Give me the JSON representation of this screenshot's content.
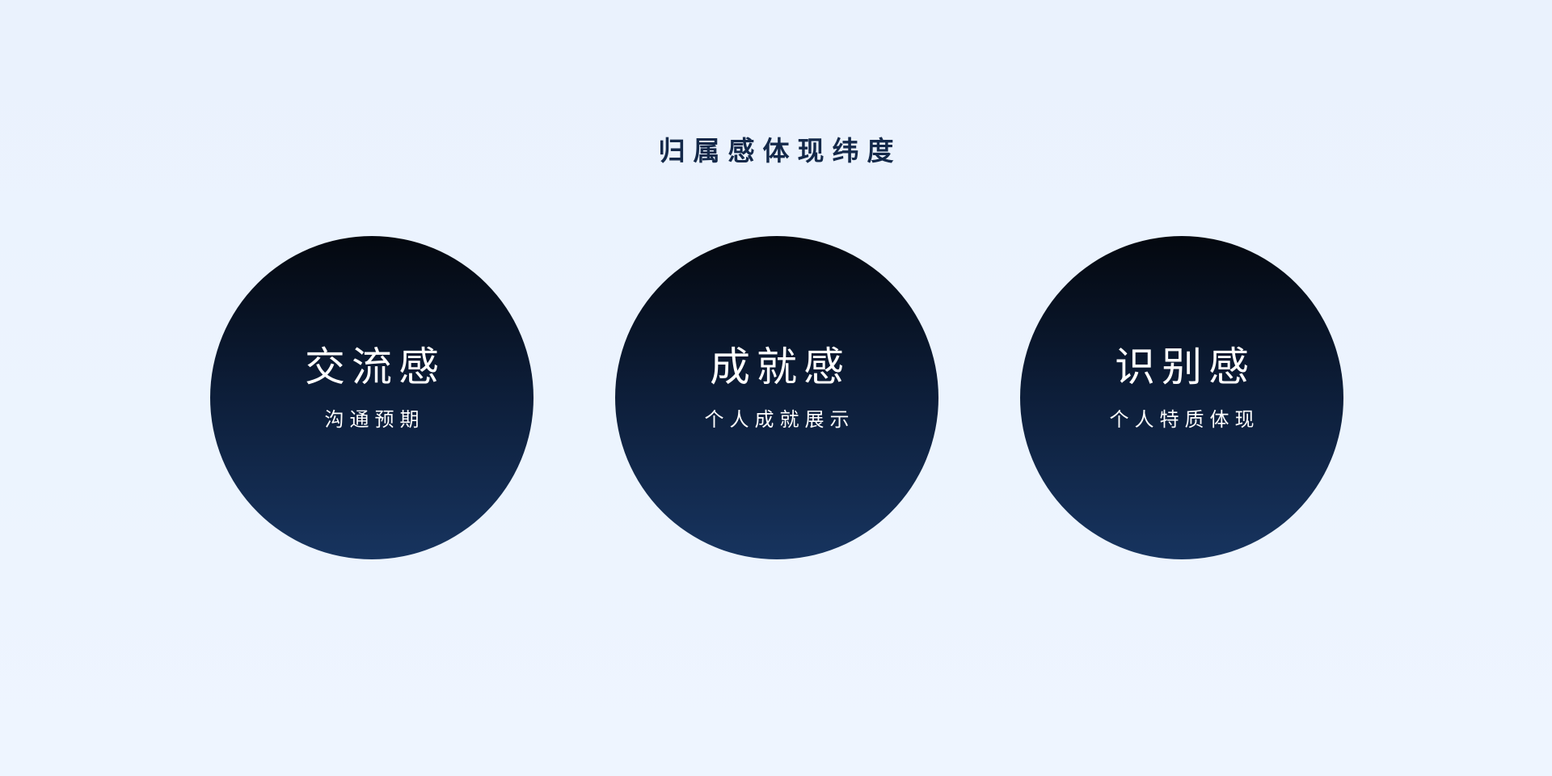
{
  "title": "归属感体现纬度",
  "items": [
    {
      "title": "交流感",
      "subtitle": "沟通预期"
    },
    {
      "title": "成就感",
      "subtitle": "个人成就展示"
    },
    {
      "title": "识别感",
      "subtitle": "个人特质体现"
    }
  ],
  "colors": {
    "background": "#EDF4FF",
    "title": "#14294A",
    "circle_top": "#04080F",
    "circle_bottom": "#17345F",
    "circle_text": "#FFFFFF"
  }
}
